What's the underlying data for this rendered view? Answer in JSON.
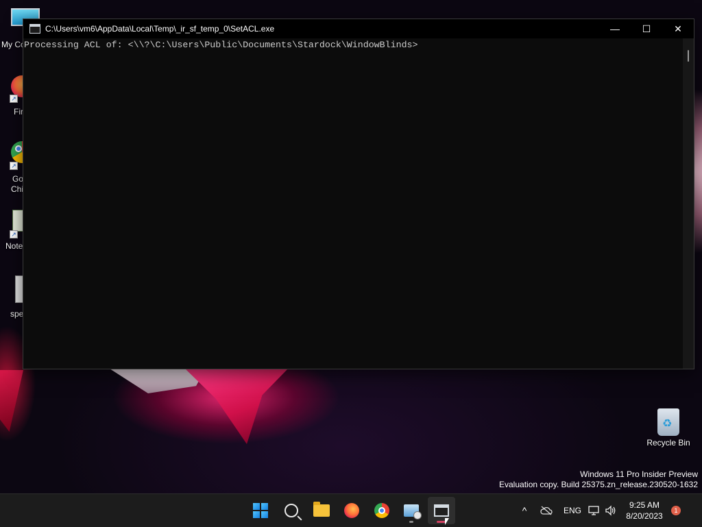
{
  "desktop": {
    "icons": [
      {
        "label": "My Co"
      },
      {
        "label": "Fir"
      },
      {
        "label": "Go"
      },
      {
        "label": "Chi"
      },
      {
        "label": "Note"
      },
      {
        "label": "spe"
      }
    ],
    "recycle_bin": {
      "label": "Recycle Bin",
      "icon": "recycle-bin-icon"
    },
    "watermark": {
      "line1": "Windows 11 Pro Insider Preview",
      "line2": "Evaluation copy. Build 25375.zn_release.230520-1632"
    }
  },
  "window": {
    "title": "C:\\Users\\vm6\\AppData\\Local\\Temp\\_ir_sf_temp_0\\SetACL.exe",
    "console_output": "Processing ACL of: <\\\\?\\C:\\Users\\Public\\Documents\\Stardock\\WindowBlinds>",
    "minimize_glyph": "—",
    "maximize_glyph": "☐",
    "close_glyph": "✕"
  },
  "taskbar": {
    "apps": [
      "start-icon",
      "search-icon",
      "file-explorer-icon",
      "firefox-icon",
      "chrome-icon",
      "network-app-icon",
      "console-app-icon"
    ],
    "tray": {
      "chevron": "^",
      "language": "ENG",
      "time": "9:25 AM",
      "date": "8/20/2023",
      "notification_count": "1"
    }
  }
}
